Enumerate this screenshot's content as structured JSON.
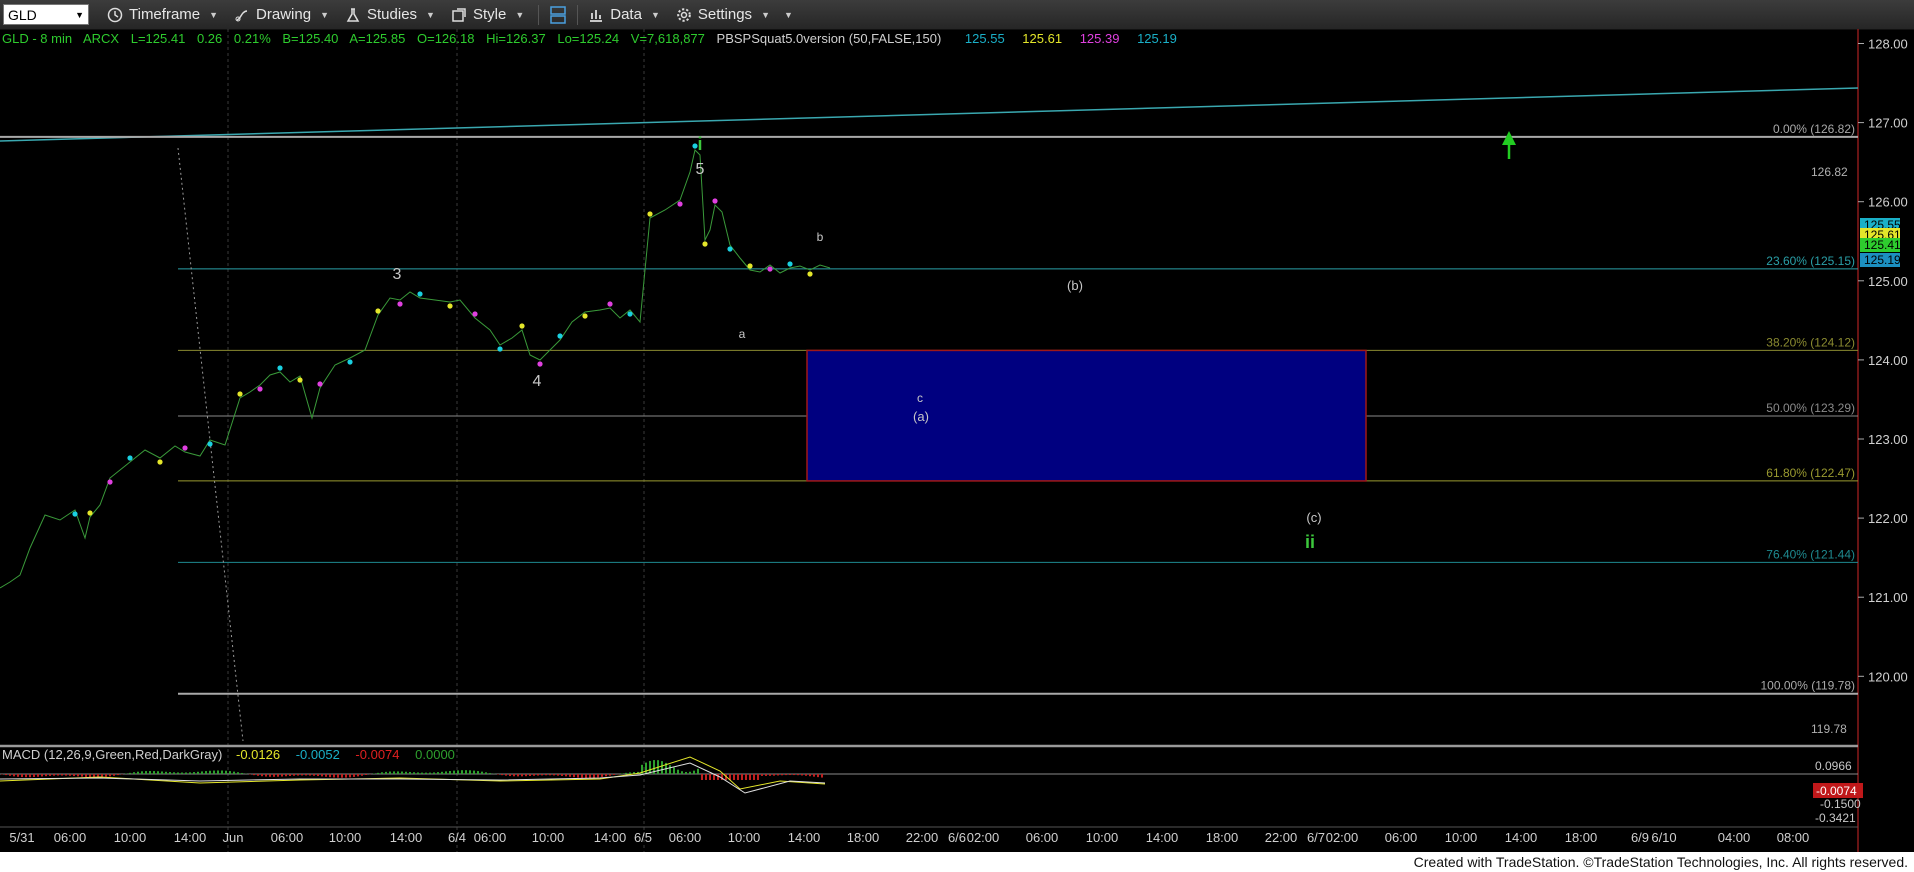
{
  "toolbar": {
    "symbol": "GLD",
    "timeframe": "Timeframe",
    "drawing": "Drawing",
    "studies": "Studies",
    "style": "Style",
    "data": "Data",
    "settings": "Settings"
  },
  "status": {
    "symbol_interval": "GLD - 8 min",
    "exchange": "ARCX",
    "last": "L=125.41",
    "change": "0.26",
    "change_pct": "0.21%",
    "bid": "B=125.40",
    "ask": "A=125.85",
    "open": "O=126.18",
    "high": "Hi=126.37",
    "low": "Lo=125.24",
    "volume": "V=7,618,877",
    "indicator": "PBSPSquat5.0version (50,FALSE,150)",
    "ind_v1": "125.55",
    "ind_v2": "125.61",
    "ind_v3": "125.39",
    "ind_v4": "125.19"
  },
  "price_axis": {
    "ticks": [
      "128.00",
      "127.00",
      "126.00",
      "125.00",
      "124.00",
      "123.00",
      "122.00",
      "121.00",
      "120.00"
    ],
    "badges": [
      {
        "value": "125.55",
        "color": "#1ab0c8"
      },
      {
        "value": "125.61",
        "color": "#e4e62a"
      },
      {
        "value": "125.41",
        "color": "#2ecc2e"
      },
      {
        "value": "125.19",
        "color": "#1c8fc0"
      }
    ],
    "top_label": "126.82",
    "bottom_label": "119.78"
  },
  "fib_levels": [
    {
      "label": "0.00% (126.82)",
      "price": 126.82,
      "color": "#a9a9a9"
    },
    {
      "label": "23.60% (125.15)",
      "price": 125.15,
      "color": "#2aa0a8"
    },
    {
      "label": "38.20% (124.12)",
      "price": 124.12,
      "color": "#8a8a30"
    },
    {
      "label": "50.00% (123.29)",
      "price": 123.29,
      "color": "#8a8a8a"
    },
    {
      "label": "61.80% (122.47)",
      "price": 122.47,
      "color": "#9a9a30"
    },
    {
      "label": "76.40% (121.44)",
      "price": 121.44,
      "color": "#1e8a90"
    },
    {
      "label": "100.00% (119.78)",
      "price": 119.78,
      "color": "#a9a9a9"
    }
  ],
  "wave_labels": [
    {
      "text": "i",
      "color": "#3cc83c"
    },
    {
      "text": "5",
      "color": "#c8c8c8"
    },
    {
      "text": "3",
      "color": "#c8c8c8"
    },
    {
      "text": "4",
      "color": "#c8c8c8"
    },
    {
      "text": "a",
      "color": "#c8c8c8"
    },
    {
      "text": "b",
      "color": "#c8c8c8"
    },
    {
      "text": "c",
      "color": "#c8c8c8"
    },
    {
      "text": "(a)",
      "color": "#c8c8c8"
    },
    {
      "text": "(b)",
      "color": "#c8c8c8"
    },
    {
      "text": "(c)",
      "color": "#c8c8c8"
    },
    {
      "text": "ii",
      "color": "#3cc83c"
    }
  ],
  "macd": {
    "label": "MACD (12,26,9,Green,Red,DarkGray)",
    "v1": "-0.0126",
    "v2": "-0.0052",
    "v3": "-0.0074",
    "v4": "0.0000",
    "ticks": [
      "0.0966",
      "-0.1500",
      "-0.3421"
    ],
    "badge": "-0.0074"
  },
  "time_axis": {
    "labels": [
      "5/31",
      "06:00",
      "10:00",
      "14:00",
      "Jun",
      "06:00",
      "10:00",
      "14:00",
      "6/4",
      "06:00",
      "10:00",
      "14:00",
      "6/5",
      "06:00",
      "10:00",
      "14:00",
      "18:00",
      "22:00",
      "6/6",
      "02:00",
      "06:00",
      "10:00",
      "14:00",
      "18:00",
      "22:00",
      "6/7",
      "02:00",
      "06:00",
      "10:00",
      "14:00",
      "18:00",
      "6/9",
      "6/10",
      "04:00",
      "08:00"
    ]
  },
  "footer": "Created with TradeStation. ©TradeStation Technologies, Inc. All rights reserved.",
  "colors": {
    "target_box": "#000080",
    "target_border": "#a01818",
    "trend_line": "#3aa8b0",
    "up_arrow": "#22cc22"
  }
}
